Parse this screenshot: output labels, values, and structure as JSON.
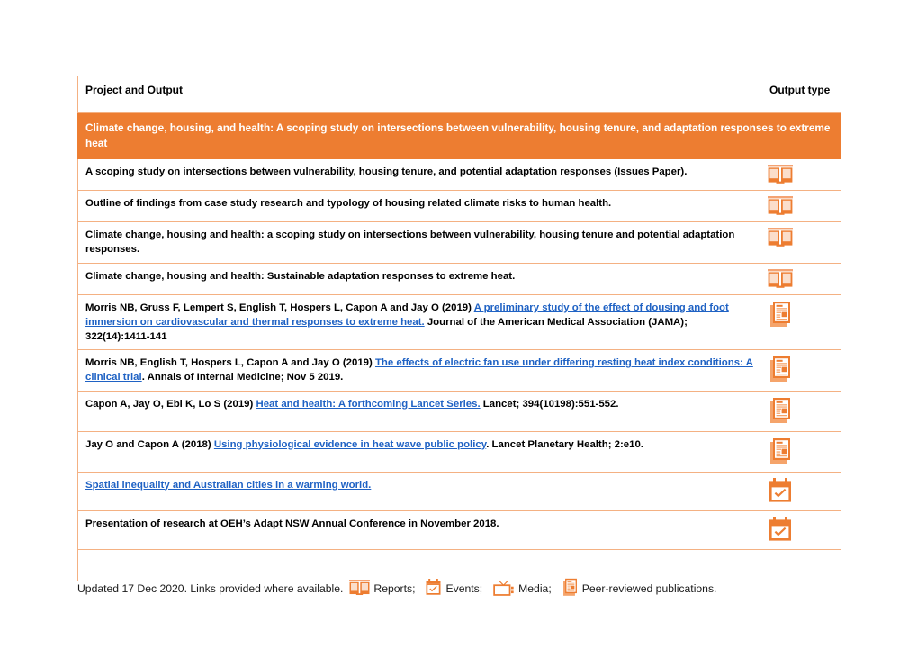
{
  "table": {
    "columns": [
      "Project and Output",
      "Output type"
    ],
    "project_band": "Climate change, housing, and health: A scoping study on intersections between vulnerability, housing tenure, and adaptation responses to extreme heat",
    "rows": [
      {
        "text": "A scoping study on intersections between vulnerability, housing tenure, and potential adaptation responses (Issues Paper).",
        "icon": "book-icon"
      },
      {
        "text": "Outline of findings from case study research and typology of housing related climate risks to human health.",
        "icon": "book-icon"
      },
      {
        "text": "Climate change, housing and health: a scoping study on intersections between vulnerability, housing tenure and potential adaptation responses.",
        "icon": "book-icon"
      },
      {
        "text": "Climate change, housing and health: Sustainable adaptation responses to extreme heat.",
        "icon": "book-icon"
      },
      {
        "prefix": "Morris NB, Gruss F, Lempert S, English T, Hospers L, Capon A and Jay O (2019) ",
        "link": "A preliminary study of the effect of dousing and foot immersion on cardiovascular and thermal responses to extreme heat.",
        "suffix": " Journal of the American Medical Association (JAMA); 322(14):1411-141",
        "icon": "publication-icon"
      },
      {
        "prefix": "Morris NB, English T, Hospers L, Capon A and Jay O (2019) ",
        "link": "The effects of electric fan use under differing resting heat index conditions: A clinical trial",
        "suffix": ". Annals of Internal Medicine; Nov 5 2019.",
        "icon": "publication-icon"
      },
      {
        "prefix": "Capon A, Jay O, Ebi K, Lo S (2019) ",
        "link": "Heat and health: A forthcoming Lancet Series.",
        "suffix": " Lancet; 394(10198):551-552.",
        "icon": "publication-icon"
      },
      {
        "prefix": "Jay O and Capon A (2018) ",
        "link": "Using physiological evidence in heat wave public policy",
        "suffix": ". Lancet Planetary Health; 2:e10.",
        "icon": "publication-icon"
      },
      {
        "prefix": "",
        "link": "Spatial inequality and Australian cities in a warming world.",
        "suffix": "",
        "icon": "event-icon"
      },
      {
        "text": "Presentation of research at OEH’s Adapt NSW Annual Conference in November 2018.",
        "icon": "event-icon"
      },
      {
        "text": "",
        "icon": "none"
      }
    ]
  },
  "legend": {
    "updated": "Updated 17 Dec 2020. Links provided where available.",
    "items": [
      {
        "icon": "book-icon",
        "label": "Reports;"
      },
      {
        "icon": "event-icon",
        "label": "Events;"
      },
      {
        "icon": "media-icon",
        "label": "Media;"
      },
      {
        "icon": "publication-icon",
        "label": "Peer-reviewed publications."
      }
    ]
  },
  "colors": {
    "accent_orange": "#ED7D31",
    "border_orange": "#F4B183",
    "link_blue": "#1F62C4"
  }
}
